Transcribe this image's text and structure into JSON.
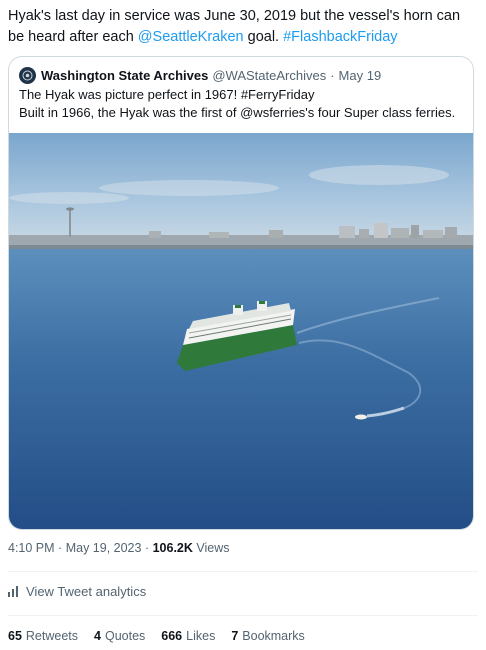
{
  "tweet": {
    "text_part1": "Hyak's last day in service was June 30, 2019 but the vessel's horn can be heard after each ",
    "mention": "@SeattleKraken",
    "text_part2": " goal. ",
    "hashtag": "#FlashbackFriday"
  },
  "quote": {
    "author_name": "Washington State Archives",
    "author_handle": "@WAStateArchives",
    "separator": "·",
    "date": "May 19",
    "line1": "The Hyak was picture perfect in 1967! #FerryFriday",
    "line2": "Built in 1966, the Hyak was the first of @wsferries's four Super class ferries."
  },
  "meta": {
    "time": "4:10 PM",
    "separator": "·",
    "date": "May 19, 2023",
    "separator2": "·",
    "views_count": "106.2K",
    "views_label": "Views"
  },
  "analytics": {
    "label": "View Tweet analytics",
    "icon": "bar-chart-icon"
  },
  "stats": [
    {
      "count": "65",
      "label": "Retweets"
    },
    {
      "count": "4",
      "label": "Quotes"
    },
    {
      "count": "666",
      "label": "Likes"
    },
    {
      "count": "7",
      "label": "Bookmarks"
    }
  ],
  "colors": {
    "link": "#1d9bf0",
    "muted": "#536471",
    "text": "#0f1419",
    "border": "#cfd9de"
  }
}
